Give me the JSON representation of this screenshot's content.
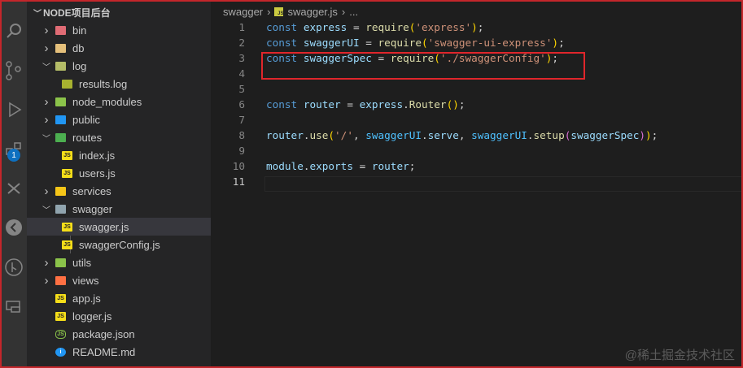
{
  "explorer": {
    "root_label": "NODE项目后台",
    "items": [
      {
        "label": "bin",
        "type": "folder",
        "depth": 0,
        "expanded": false,
        "color": "#e06c75"
      },
      {
        "label": "db",
        "type": "folder",
        "depth": 0,
        "expanded": false,
        "color": "#e5c07b"
      },
      {
        "label": "log",
        "type": "folder",
        "depth": 0,
        "expanded": true,
        "color": "#b5bd68"
      },
      {
        "label": "results.log",
        "type": "file",
        "depth": 1,
        "icon": "log",
        "color": "#a8b230"
      },
      {
        "label": "node_modules",
        "type": "folder",
        "depth": 0,
        "expanded": false,
        "color": "#8bc34a"
      },
      {
        "label": "public",
        "type": "folder",
        "depth": 0,
        "expanded": false,
        "color": "#2196f3"
      },
      {
        "label": "routes",
        "type": "folder",
        "depth": 0,
        "expanded": true,
        "color": "#4caf50"
      },
      {
        "label": "index.js",
        "type": "file",
        "depth": 1,
        "icon": "js",
        "color": "#f5de19"
      },
      {
        "label": "users.js",
        "type": "file",
        "depth": 1,
        "icon": "js",
        "color": "#f5de19"
      },
      {
        "label": "services",
        "type": "folder",
        "depth": 0,
        "expanded": false,
        "color": "#f5c518"
      },
      {
        "label": "swagger",
        "type": "folder",
        "depth": 0,
        "expanded": true,
        "color": "#90a4ae"
      },
      {
        "label": "swagger.js",
        "type": "file",
        "depth": 1,
        "icon": "js",
        "color": "#f5de19",
        "selected": true
      },
      {
        "label": "swaggerConfig.js",
        "type": "file",
        "depth": 1,
        "icon": "js",
        "color": "#f5de19"
      },
      {
        "label": "utils",
        "type": "folder",
        "depth": 0,
        "expanded": false,
        "color": "#8bc34a"
      },
      {
        "label": "views",
        "type": "folder",
        "depth": 0,
        "expanded": false,
        "color": "#ff7043"
      },
      {
        "label": "app.js",
        "type": "file",
        "depth": 0,
        "icon": "js",
        "color": "#f5de19"
      },
      {
        "label": "logger.js",
        "type": "file",
        "depth": 0,
        "icon": "js",
        "color": "#f5de19"
      },
      {
        "label": "package.json",
        "type": "file",
        "depth": 0,
        "icon": "node",
        "color": "#8bc34a"
      },
      {
        "label": "README.md",
        "type": "file",
        "depth": 0,
        "icon": "info",
        "color": "#2196f3"
      }
    ]
  },
  "activity_bar": {
    "extensions_badge": "1"
  },
  "breadcrumb": {
    "folder": "swagger",
    "file": "swagger.js",
    "ellipsis": "..."
  },
  "code": [
    {
      "n": "1",
      "t": [
        [
          "const",
          "kw"
        ],
        [
          " ",
          "pn"
        ],
        [
          "express",
          "var"
        ],
        [
          " = ",
          "pn"
        ],
        [
          "require",
          "fn"
        ],
        [
          "(",
          "br"
        ],
        [
          "'express'",
          "str"
        ],
        [
          ")",
          "br"
        ],
        [
          ";",
          "pn"
        ]
      ]
    },
    {
      "n": "2",
      "t": [
        [
          "const",
          "kw"
        ],
        [
          " ",
          "pn"
        ],
        [
          "swaggerUI",
          "var"
        ],
        [
          " = ",
          "pn"
        ],
        [
          "require",
          "fn"
        ],
        [
          "(",
          "br"
        ],
        [
          "'swagger-ui-express'",
          "str"
        ],
        [
          ")",
          "br"
        ],
        [
          ";",
          "pn"
        ]
      ]
    },
    {
      "n": "3",
      "t": [
        [
          "const",
          "kw"
        ],
        [
          " ",
          "pn"
        ],
        [
          "swaggerSpec",
          "var"
        ],
        [
          " = ",
          "pn"
        ],
        [
          "require",
          "fn"
        ],
        [
          "(",
          "br"
        ],
        [
          "'./swaggerConfig'",
          "str"
        ],
        [
          ")",
          "br"
        ],
        [
          ";",
          "pn"
        ]
      ]
    },
    {
      "n": "4",
      "t": []
    },
    {
      "n": "5",
      "t": []
    },
    {
      "n": "6",
      "t": [
        [
          "const",
          "kw"
        ],
        [
          " ",
          "pn"
        ],
        [
          "router",
          "var"
        ],
        [
          " = ",
          "pn"
        ],
        [
          "express",
          "var"
        ],
        [
          ".",
          "pn"
        ],
        [
          "Router",
          "fn"
        ],
        [
          "()",
          "br"
        ],
        [
          ";",
          "pn"
        ]
      ]
    },
    {
      "n": "7",
      "t": []
    },
    {
      "n": "8",
      "t": [
        [
          "router",
          "var"
        ],
        [
          ".",
          "pn"
        ],
        [
          "use",
          "fn"
        ],
        [
          "(",
          "br"
        ],
        [
          "'/'",
          "str"
        ],
        [
          ", ",
          "pn"
        ],
        [
          "swaggerUI",
          "cst"
        ],
        [
          ".",
          "pn"
        ],
        [
          "serve",
          "var"
        ],
        [
          ", ",
          "pn"
        ],
        [
          "swaggerUI",
          "cst"
        ],
        [
          ".",
          "pn"
        ],
        [
          "setup",
          "fn"
        ],
        [
          "(",
          "br2"
        ],
        [
          "swaggerSpec",
          "var"
        ],
        [
          ")",
          "br2"
        ],
        [
          ")",
          "br"
        ],
        [
          ";",
          "pn"
        ]
      ]
    },
    {
      "n": "9",
      "t": []
    },
    {
      "n": "10",
      "t": [
        [
          "module",
          "var"
        ],
        [
          ".",
          "pn"
        ],
        [
          "exports",
          "var"
        ],
        [
          " = ",
          "pn"
        ],
        [
          "router",
          "var"
        ],
        [
          ";",
          "pn"
        ]
      ]
    },
    {
      "n": "11",
      "t": [],
      "current": true
    }
  ],
  "watermark": "@稀土掘金技术社区"
}
